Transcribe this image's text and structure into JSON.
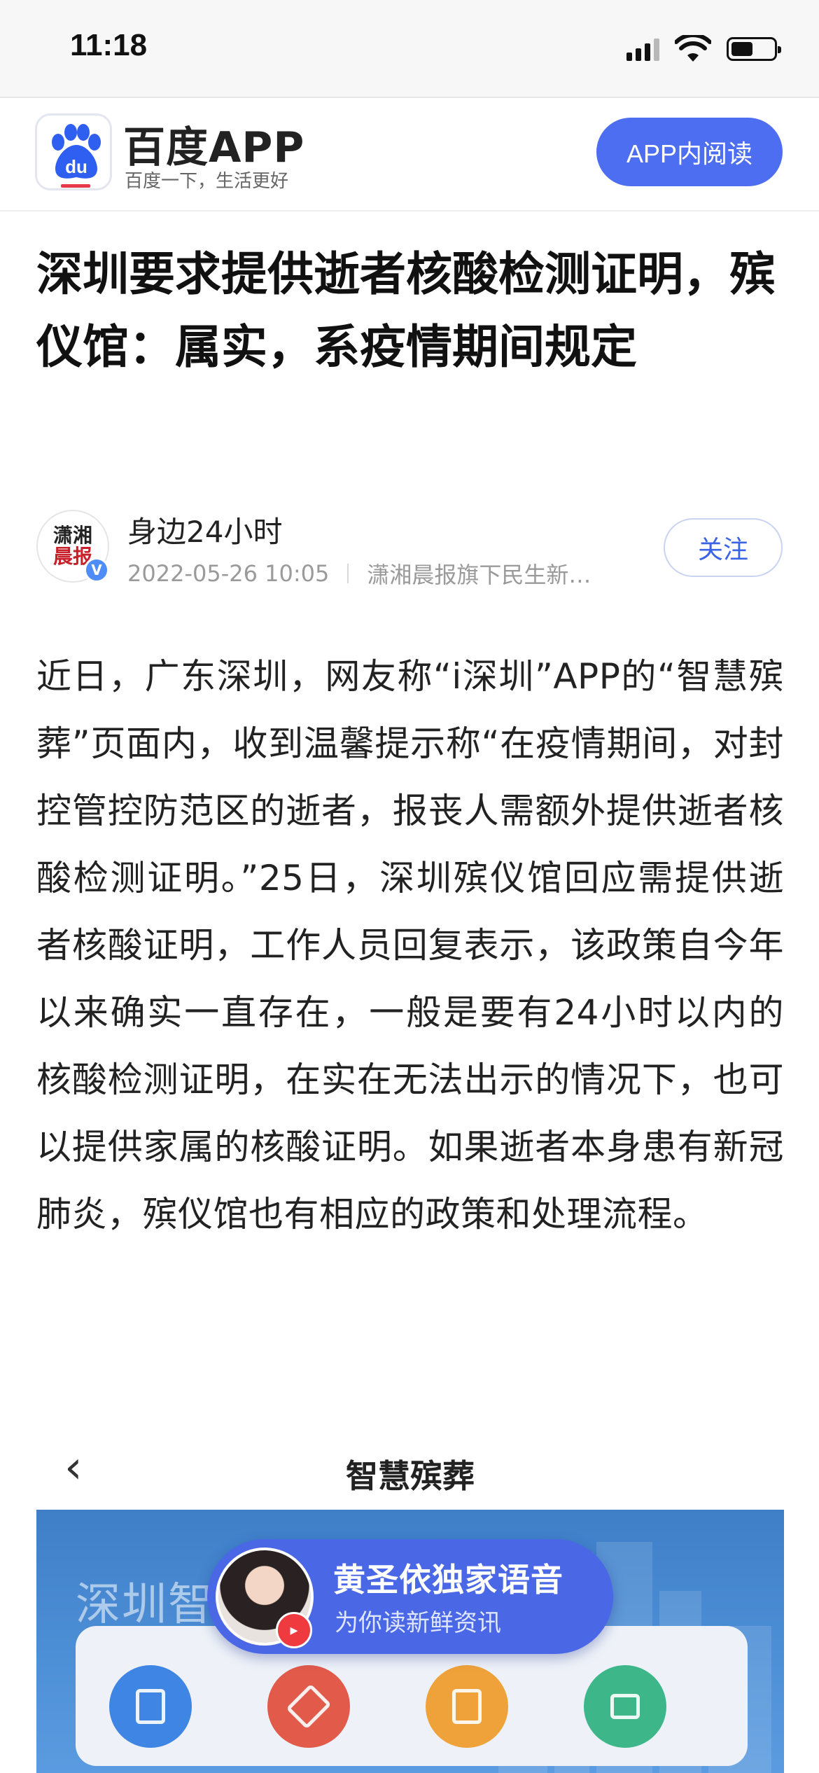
{
  "status_bar": {
    "time": "11:18"
  },
  "app_banner": {
    "name": "百度APP",
    "slogan": "百度一下，生活更好",
    "open_button": "APP内阅读",
    "logo_text": "du"
  },
  "article": {
    "title": "深圳要求提供逝者核酸检测证明，殡仪馆：属实，系疫情期间规定",
    "author": {
      "avatar_line1": "潇湘",
      "avatar_line2": "晨报",
      "name": "身边24小时",
      "date": "2022-05-26 10:05",
      "source": "潇湘晨报旗下民生新…",
      "verified": "V"
    },
    "follow_button": "关注",
    "body": "近日，广东深圳，网友称“i深圳”APP的“智慧殡葬”页面内，收到温馨提示称“在疫情期间，对封控管控防范区的逝者，报丧人需额外提供逝者核酸检测证明。”25日，深圳殡仪馆回应需提供逝者核酸证明，工作人员回复表示，该政策自今年以来确实一直存在，一般是要有24小时以内的核酸检测证明，在实在无法出示的情况下，也可以提供家属的核酸证明。如果逝者本身患有新冠肺炎，殡仪馆也有相应的政策和处理流程。"
  },
  "embedded_screenshot": {
    "back_glyph": "‹",
    "title": "智慧殡葬",
    "banner_text": "深圳智"
  },
  "voice_promo": {
    "title": "黄圣依独家语音",
    "subtitle": "为你读新鲜资讯"
  },
  "colors": {
    "accent": "#4e6ef2",
    "follow_text": "#3b63e6",
    "verified": "#4e8cf7",
    "voice_dot": "#ef3a40"
  }
}
